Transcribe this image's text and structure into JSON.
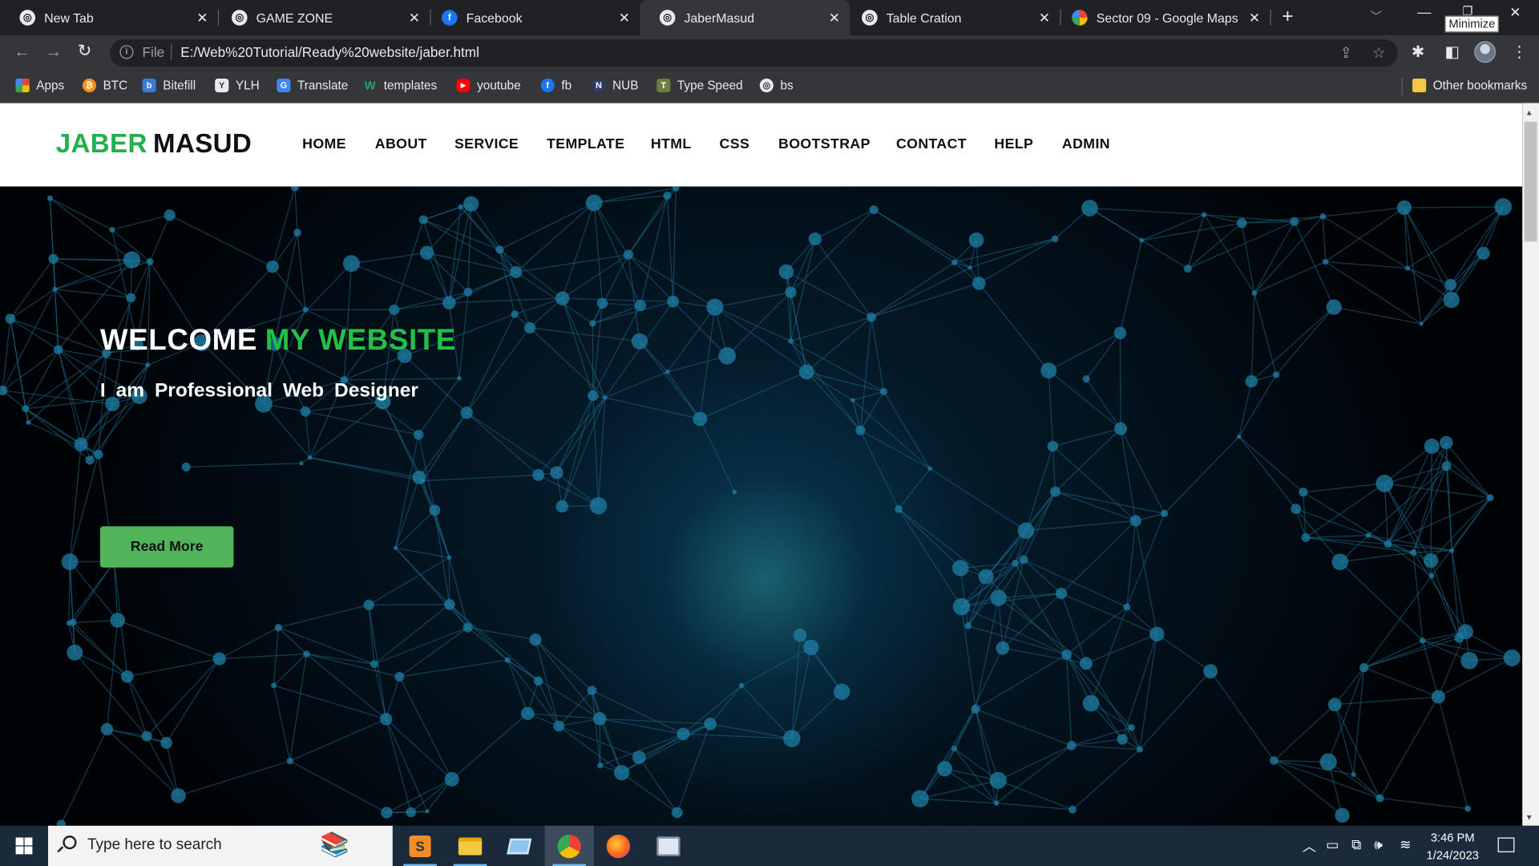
{
  "browser": {
    "tabs": [
      {
        "title": "New Tab",
        "icon": "chrome-icon",
        "active": false
      },
      {
        "title": "GAME ZONE",
        "icon": "globe-icon",
        "active": false
      },
      {
        "title": "Facebook",
        "icon": "facebook-icon",
        "active": false
      },
      {
        "title": "JaberMasud",
        "icon": "globe-icon",
        "active": true
      },
      {
        "title": "Table Cration",
        "icon": "globe-icon",
        "active": false
      },
      {
        "title": "Sector 09 - Google Maps",
        "icon": "maps-icon",
        "active": false
      }
    ],
    "tooltip": "Minimize",
    "address": {
      "scheme_label": "File",
      "url": "E:/Web%20Tutorial/Ready%20website/jaber.html"
    },
    "bookmarks": [
      {
        "label": "Apps",
        "color": "#ea4335"
      },
      {
        "label": "BTC",
        "color": "#f7931a"
      },
      {
        "label": "Bitefill",
        "color": "#3a7bd5"
      },
      {
        "label": "YLH",
        "color": "#e8eaed"
      },
      {
        "label": "Translate",
        "color": "#4285f4"
      },
      {
        "label": "templates",
        "color": "#21a56b"
      },
      {
        "label": "youtube",
        "color": "#ff0000"
      },
      {
        "label": "fb",
        "color": "#1877f2"
      },
      {
        "label": "NUB",
        "color": "#2b3a67"
      },
      {
        "label": "Type Speed",
        "color": "#6b7f3a"
      },
      {
        "label": "bs",
        "color": "#e8eaed"
      }
    ],
    "other_bookmarks": "Other bookmarks"
  },
  "site": {
    "logo_first": "JABER",
    "logo_second": "MASUD",
    "nav": [
      "HOME",
      "ABOUT",
      "SERVICE",
      "TEMPLATE",
      "HTML",
      "CSS",
      "BOOTSTRAP",
      "CONTACT",
      "HELP",
      "ADMIN"
    ],
    "hero": {
      "title_white": "WELCOME",
      "title_green": "MY WEBSITE",
      "subtitle": "I am Professional Web Designer",
      "button": "Read More"
    },
    "colors": {
      "accent": "#22b04b",
      "button": "#52b45a"
    }
  },
  "taskbar": {
    "search_placeholder": "Type here to search",
    "time": "3:46 PM",
    "date": "1/24/2023"
  }
}
